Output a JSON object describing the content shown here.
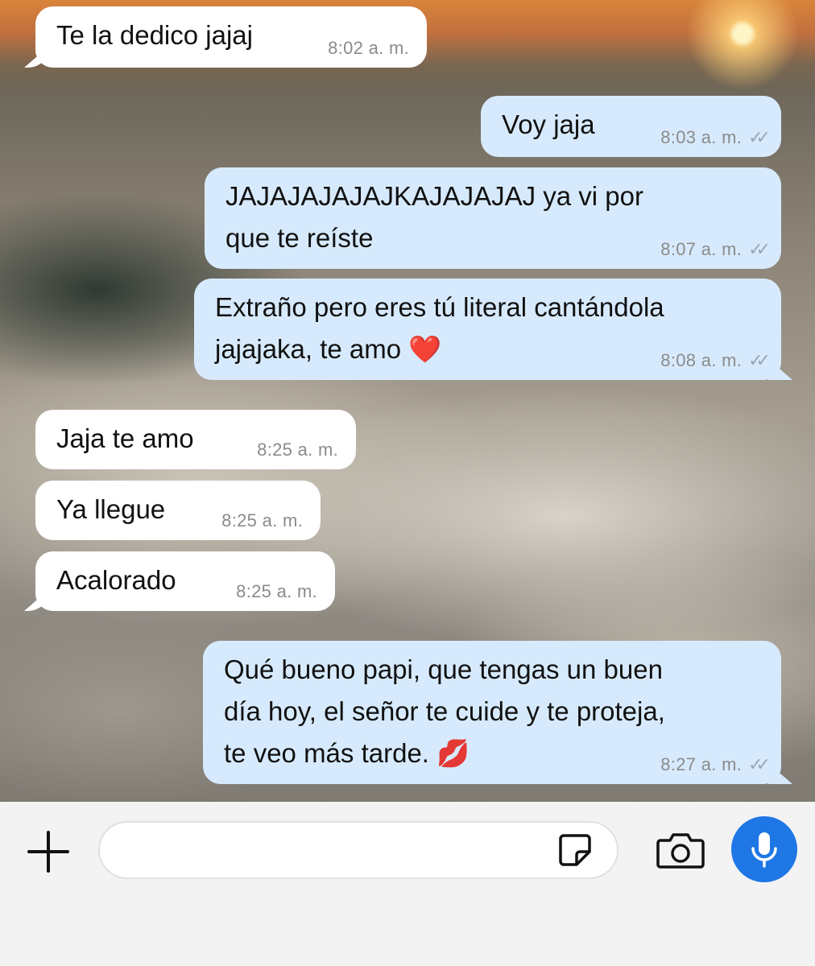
{
  "messages": [
    {
      "dir": "in",
      "text": "Te la dedico jajaj",
      "time": "8:02 a. m.",
      "read": false
    },
    {
      "dir": "out",
      "text": "Voy jaja",
      "time": "8:03 a. m.",
      "read": true
    },
    {
      "dir": "out",
      "text": "JAJAJAJAJAJKAJAJAJAJ ya vi por\nque te reíste",
      "time": "8:07 a. m.",
      "read": true
    },
    {
      "dir": "out",
      "text": "Extraño pero eres tú literal cantándola\njajajaka, te amo ❤️",
      "time": "8:08 a. m.",
      "read": true
    },
    {
      "dir": "in",
      "text": "Jaja te amo",
      "time": "8:25 a. m.",
      "read": false
    },
    {
      "dir": "in",
      "text": "Ya llegue",
      "time": "8:25 a. m.",
      "read": false
    },
    {
      "dir": "in",
      "text": "Acalorado",
      "time": "8:25 a. m.",
      "read": false
    },
    {
      "dir": "out",
      "text": "Qué bueno papi, que tengas un buen\ndía hoy, el señor te cuide y te proteja,\nte veo más tarde. 💋",
      "time": "8:27 a. m.",
      "read": true
    }
  ],
  "composer": {
    "placeholder": "",
    "icons": {
      "attach": "plus-icon",
      "sticker": "sticker-icon",
      "camera": "camera-icon",
      "mic": "microphone-icon"
    }
  },
  "colors": {
    "incoming_bubble": "#ffffff",
    "outgoing_bubble": "#d7eafd",
    "mic_button": "#1f77e6",
    "read_ticks": "#9aa6b5"
  }
}
